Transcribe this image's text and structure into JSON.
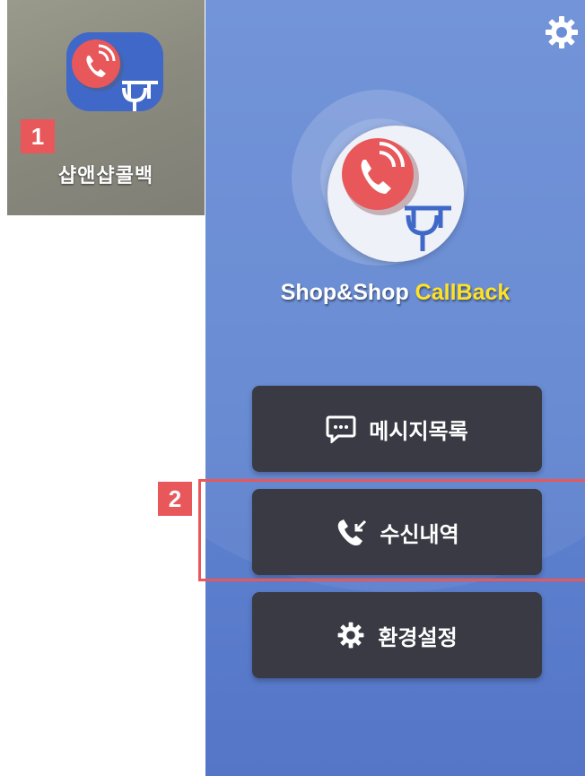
{
  "launcher": {
    "app_label": "샵앤샵콜백",
    "icon": "shopandshop-callback-app-icon"
  },
  "callouts": {
    "step1": "1",
    "step2": "2"
  },
  "app": {
    "brand_part1": "Shop&Shop ",
    "brand_part2": "CallBack",
    "settings_icon": "gear-icon",
    "menu": {
      "messages_label": "메시지목록",
      "messages_icon": "chat-bubble-icon",
      "history_label": "수신내역",
      "history_icon": "incoming-call-icon",
      "settings_label": "환경설정",
      "settings_icon": "gear-icon"
    }
  },
  "colors": {
    "phone_bg": "#6b8ed6",
    "button_bg": "#393a44",
    "accent_red": "#e8575a",
    "brand_yellow": "#ffe224"
  }
}
